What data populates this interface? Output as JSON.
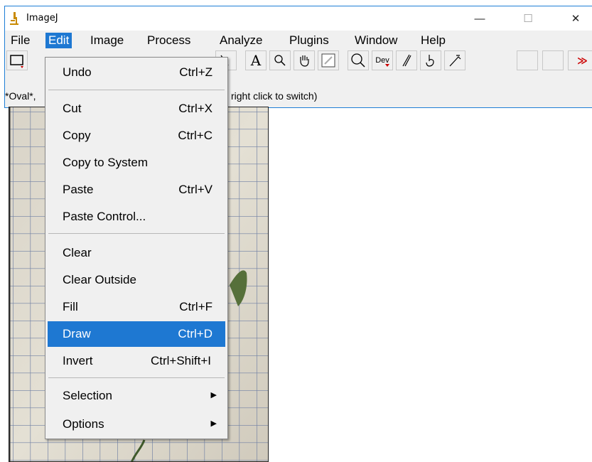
{
  "window": {
    "title": "ImageJ",
    "minimize_glyph": "—",
    "maximize_glyph": "☐",
    "close_glyph": "✕"
  },
  "menubar": {
    "items": [
      "File",
      "Edit",
      "Image",
      "Process",
      "Analyze",
      "Plugins",
      "Window",
      "Help"
    ],
    "active": "Edit"
  },
  "toolbar": {
    "text_tool_label": "A",
    "dev_label": "Dev",
    "more_label": "≫"
  },
  "status": {
    "left": "*Oval*,",
    "right": "right click to switch)"
  },
  "edit_menu": {
    "items": [
      {
        "label": "Undo",
        "shortcut": "Ctrl+Z"
      },
      {
        "label": "Cut",
        "shortcut": "Ctrl+X"
      },
      {
        "label": "Copy",
        "shortcut": "Ctrl+C"
      },
      {
        "label": "Copy to System",
        "shortcut": ""
      },
      {
        "label": "Paste",
        "shortcut": "Ctrl+V"
      },
      {
        "label": "Paste Control...",
        "shortcut": ""
      },
      {
        "label": "Clear",
        "shortcut": ""
      },
      {
        "label": "Clear Outside",
        "shortcut": ""
      },
      {
        "label": "Fill",
        "shortcut": "Ctrl+F"
      },
      {
        "label": "Draw",
        "shortcut": "Ctrl+D"
      },
      {
        "label": "Invert",
        "shortcut": "Ctrl+Shift+I"
      },
      {
        "label": "Selection",
        "shortcut": ""
      },
      {
        "label": "Options",
        "shortcut": ""
      }
    ],
    "highlighted": "Draw"
  },
  "colors": {
    "accent": "#1e78d2",
    "window_border": "#1e7ed6",
    "menu_bg": "#f0f0f0"
  }
}
